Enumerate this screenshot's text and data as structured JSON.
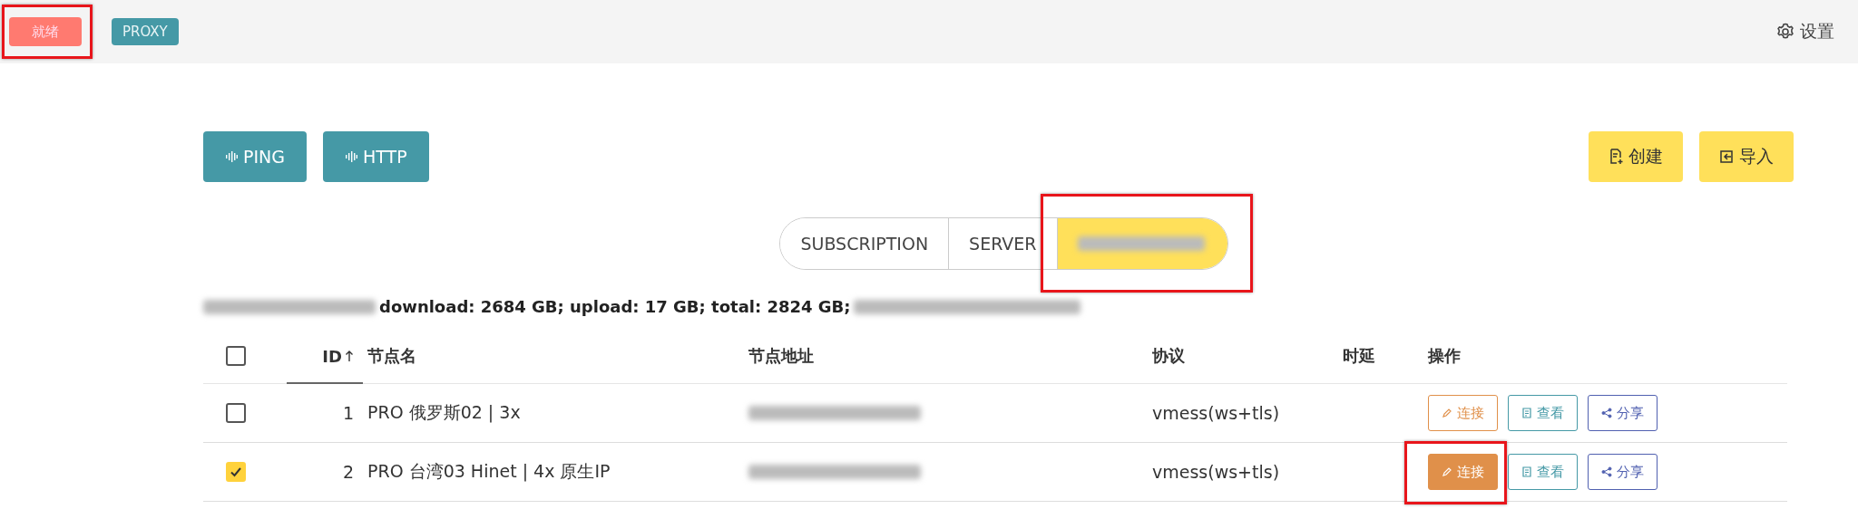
{
  "top_bar": {
    "status": {
      "label": "就绪",
      "highlighted": true
    },
    "mode": {
      "label": "PROXY"
    },
    "settings": {
      "label": "设置"
    }
  },
  "toolbar": {
    "left": [
      {
        "label": "PING",
        "kind": "wave"
      },
      {
        "label": "HTTP",
        "kind": "wave"
      }
    ],
    "right": [
      {
        "label": "创建",
        "kind": "create"
      },
      {
        "label": "导入",
        "kind": "import"
      }
    ]
  },
  "segments": [
    {
      "label": "SUBSCRIPTION",
      "selected": false,
      "blurred": false,
      "highlighted": false
    },
    {
      "label": "SERVER",
      "selected": false,
      "blurred": false,
      "highlighted": false
    },
    {
      "selected": true,
      "blurred": true,
      "highlighted": true
    }
  ],
  "stats": {
    "text": "download: 2684 GB; upload: 17 GB; total: 2824 GB;",
    "blurred_prefix": true,
    "blurred_suffix": true
  },
  "table": {
    "header_checked": false,
    "columns": [
      {
        "label": "ID",
        "sorted": true
      },
      {
        "label": "节点名",
        "sorted": false
      },
      {
        "label": "节点地址",
        "sorted": false
      },
      {
        "label": "协议",
        "sorted": false
      },
      {
        "label": "时延",
        "sorted": false
      },
      {
        "label": "操作",
        "sorted": false
      }
    ],
    "rows": [
      {
        "checked": false,
        "id": "1",
        "name": "PRO 俄罗斯02 | 3x",
        "address_blurred": true,
        "protocol": "vmess(ws+tls)",
        "actions": [
          {
            "kind": "connect",
            "label": "连接",
            "active": false,
            "highlighted": false
          },
          {
            "kind": "view",
            "label": "查看",
            "active": false,
            "highlighted": false
          },
          {
            "kind": "share",
            "label": "分享",
            "active": false,
            "highlighted": false
          }
        ]
      },
      {
        "checked": true,
        "id": "2",
        "name": "PRO 台湾03 Hinet | 4x 原生IP",
        "address_blurred": true,
        "protocol": "vmess(ws+tls)",
        "actions": [
          {
            "kind": "connect",
            "label": "连接",
            "active": true,
            "highlighted": true
          },
          {
            "kind": "view",
            "label": "查看",
            "active": false,
            "highlighted": false
          },
          {
            "kind": "share",
            "label": "分享",
            "active": false,
            "highlighted": false
          }
        ]
      }
    ]
  }
}
